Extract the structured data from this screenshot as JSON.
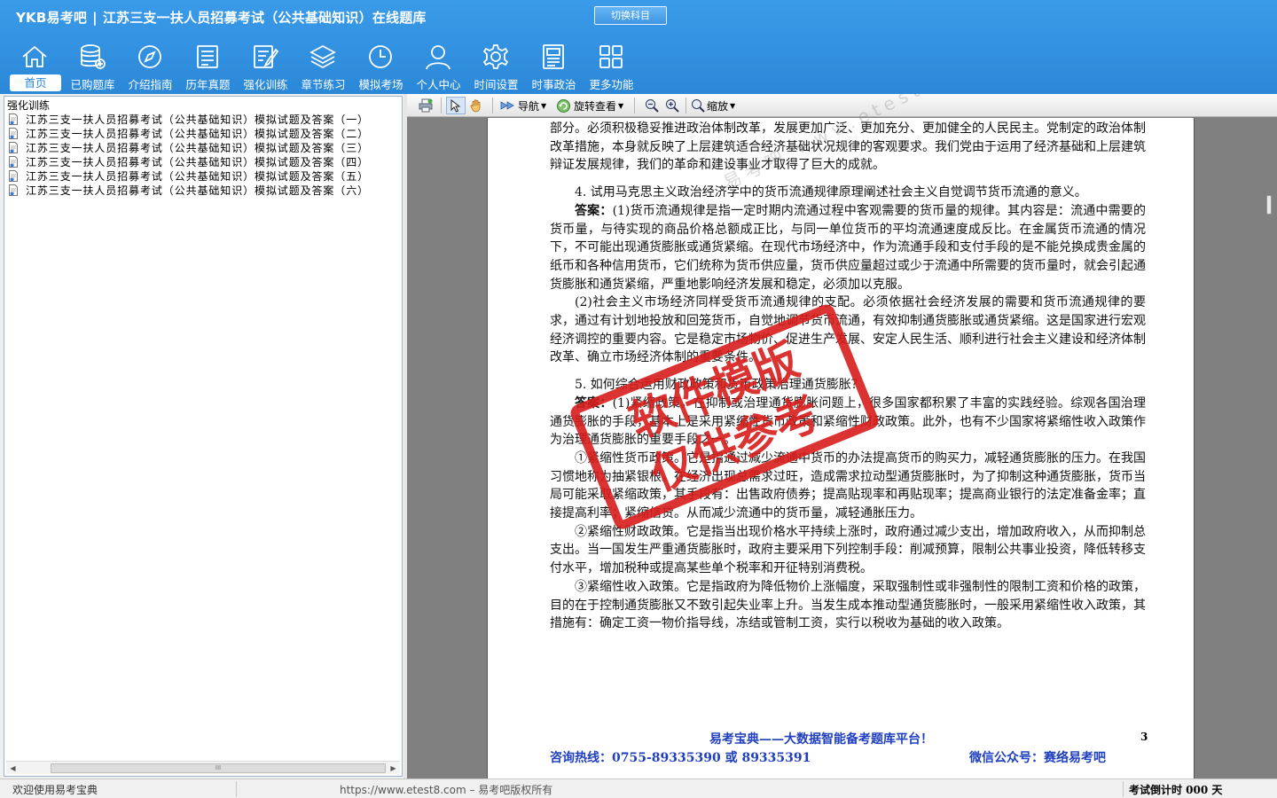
{
  "app": {
    "brand": "YKB易考吧",
    "title": "江苏三支一扶人员招募考试（公共基础知识）在线题库",
    "switch_label": "切换科目"
  },
  "nav": [
    {
      "label": "首页",
      "icon": "home-icon"
    },
    {
      "label": "已购题库",
      "icon": "database-icon"
    },
    {
      "label": "介绍指南",
      "icon": "compass-icon"
    },
    {
      "label": "历年真题",
      "icon": "document-list-icon"
    },
    {
      "label": "强化训练",
      "icon": "edit-icon"
    },
    {
      "label": "章节练习",
      "icon": "layers-icon"
    },
    {
      "label": "模拟考场",
      "icon": "clock-icon"
    },
    {
      "label": "个人中心",
      "icon": "user-icon"
    },
    {
      "label": "时间设置",
      "icon": "gear-icon"
    },
    {
      "label": "时事政治",
      "icon": "newspaper-icon"
    },
    {
      "label": "更多功能",
      "icon": "grid-icon"
    }
  ],
  "tree": {
    "root": "强化训练",
    "items": [
      "江苏三支一扶人员招募考试（公共基础知识）模拟试题及答案（一）",
      "江苏三支一扶人员招募考试（公共基础知识）模拟试题及答案（二）",
      "江苏三支一扶人员招募考试（公共基础知识）模拟试题及答案（三）",
      "江苏三支一扶人员招募考试（公共基础知识）模拟试题及答案（四）",
      "江苏三支一扶人员招募考试（公共基础知识）模拟试题及答案（五）",
      "江苏三支一扶人员招募考试（公共基础知识）模拟试题及答案（六）"
    ],
    "scroll_thumb": "III"
  },
  "toolbar": {
    "nav_label": "导航",
    "rotate_label": "旋转查看",
    "zoom_label": "缩放"
  },
  "doc": {
    "p0": "部分。必须积极稳妥推进政治体制改革，发展更加广泛、更加充分、更加健全的人民民主。党制定的政治体制改革措施，本身就反映了上层建筑适合经济基础状况规律的客观要求。我们党由于运用了经济基础和上层建筑辩证发展规律，我们的革命和建设事业才取得了巨大的成就。",
    "q4": "4. 试用马克思主义政治经济学中的货币流通规律原理阐述社会主义自觉调节货币流通的意义。",
    "a4_label": "答案：",
    "a4_p1": "(1)货币流通规律是指一定时期内流通过程中客观需要的货币量的规律。其内容是：流通中需要的货币量，与待实现的商品价格总额成正比，与同一单位货币的平均流通速度成反比。在金属货币流通的情况下，不可能出现通货膨胀或通货紧缩。在现代市场经济中，作为流通手段和支付手段的是不能兑换成贵金属的纸币和各种信用货币，它们统称为货币供应量，货币供应量超过或少于流通中所需要的货币量时，就会引起通货膨胀和通货紧缩，严重地影响经济发展和稳定，必须加以克服。",
    "a4_p2": "(2)社会主义市场经济同样受货币流通规律的支配。必须依据社会经济发展的需要和货币流通规律的要求，通过有计划地投放和回笼货币，自觉地调节货币流通，有效抑制通货膨胀或通货紧缩。这是国家进行宏观经济调控的重要内容。它是稳定市场物价、促进生产发展、安定人民生活、顺利进行社会主义建设和经济体制改革、确立市场经济体制的重要条件。",
    "q5": "5. 如何综合运用财政政策和货币政策治理通货膨胀？",
    "a5_label": "答案：",
    "a5_p1": "(1)紧缩政策。在抑制或治理通货膨胀问题上，很多国家都积累了丰富的实践经验。综观各国治理通货膨胀的手段，基本上是采用紧缩性货币政策和紧缩性财政政策。此外，也有不少国家将紧缩性收入政策作为治理通货膨胀的重要手段之一。",
    "a5_p2": "①紧缩性货币政策。它是指通过减少流通中货币的办法提高货币的购买力，减轻通货膨胀的压力。在我国习惯地称为抽紧银根。在经济出现总需求过旺，造成需求拉动型通货膨胀时，为了抑制这种通货膨胀，货币当局可能采取紧缩政策，其手段有：出售政府债券；提高贴现率和再贴现率；提高商业银行的法定准备金率；直接提高利率；紧缩信贷。从而减少流通中的货币量，减轻通胀压力。",
    "a5_p3": "②紧缩性财政政策。它是指当出现价格水平持续上涨时，政府通过减少支出，增加政府收入，从而抑制总支出。当一国发生严重通货膨胀时，政府主要采用下列控制手段：削减预算，限制公共事业投资，降低转移支付水平，增加税种或提高某些单个税率和开征特别消费税。",
    "a5_p4": "③紧缩性收入政策。它是指政府为降低物价上涨幅度，采取强制性或非强制性的限制工资和价格的政策，目的在于控制通货膨胀又不致引起失业率上升。当发生成本推动型通货膨胀时，一般采用紧缩性收入政策，其措施有：确定工资一物价指导线，冻结或管制工资，实行以税收为基础的收入政策。",
    "footer_main": "易考宝典——大数据智能备考题库平台！",
    "page_number": "3",
    "footer_phone": "咨询热线：0755-89335390 或 89335391",
    "footer_wechat": "微信公众号：赛络易考吧"
  },
  "watermark": {
    "text": "易考吧   www.etest8.com",
    "stamp_line1": "软件模版",
    "stamp_line2": "仅供参考"
  },
  "status": {
    "welcome": "欢迎使用易考宝典",
    "copyright": "https://www.etest8.com – 易考吧版权所有",
    "countdown": "考试倒计时 000 天"
  },
  "colors": {
    "header_blue": "#2b88d8",
    "footer_blue": "#1f3fbf",
    "stamp_red": "#d71c1c"
  }
}
